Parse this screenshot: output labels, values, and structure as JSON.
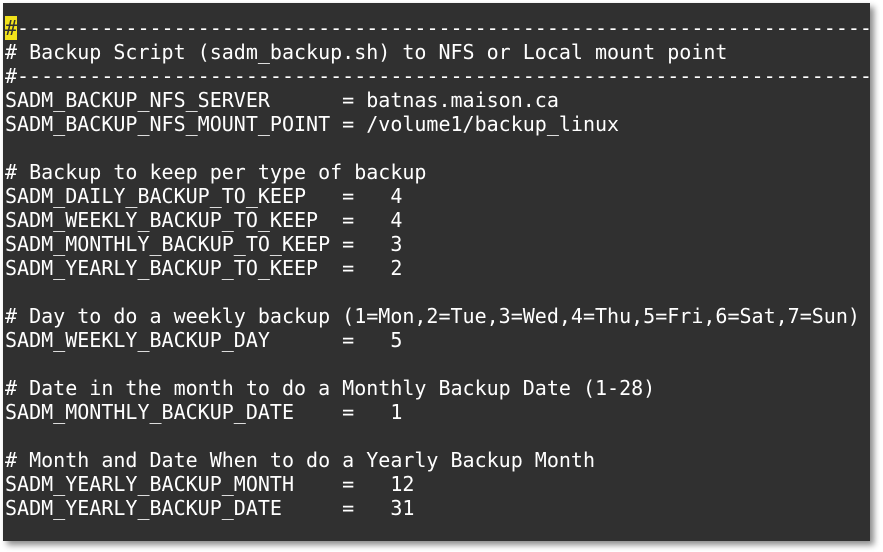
{
  "terminal": {
    "cursor_char": "#",
    "lines": [
      "-------------------------------------------------------------------------",
      "# Backup Script (sadm_backup.sh) to NFS or Local mount point",
      "#-------------------------------------------------------------------------",
      "SADM_BACKUP_NFS_SERVER      = batnas.maison.ca",
      "SADM_BACKUP_NFS_MOUNT_POINT = /volume1/backup_linux",
      "",
      "# Backup to keep per type of backup",
      "SADM_DAILY_BACKUP_TO_KEEP   =   4",
      "SADM_WEEKLY_BACKUP_TO_KEEP  =   4",
      "SADM_MONTHLY_BACKUP_TO_KEEP =   3",
      "SADM_YEARLY_BACKUP_TO_KEEP  =   2",
      "",
      "# Day to do a weekly backup (1=Mon,2=Tue,3=Wed,4=Thu,5=Fri,6=Sat,7=Sun)",
      "SADM_WEEKLY_BACKUP_DAY      =   5",
      "",
      "# Date in the month to do a Monthly Backup Date (1-28)",
      "SADM_MONTHLY_BACKUP_DATE    =   1",
      "",
      "# Month and Date When to do a Yearly Backup Month",
      "SADM_YEARLY_BACKUP_MONTH    =   12",
      "SADM_YEARLY_BACKUP_DATE     =   31"
    ]
  }
}
